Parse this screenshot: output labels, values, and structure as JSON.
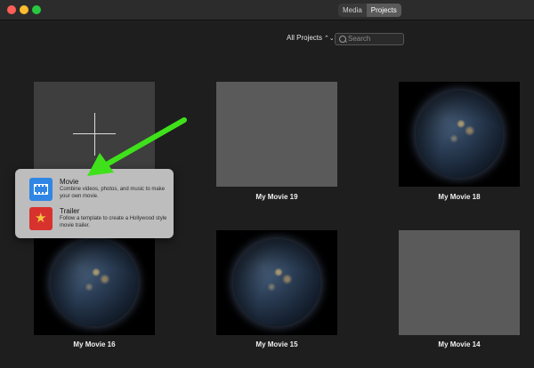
{
  "toolbar": {
    "tabs": [
      {
        "label": "Media",
        "active": false
      },
      {
        "label": "Projects",
        "active": true
      }
    ]
  },
  "filter": {
    "label": "All Projects",
    "icon": "up-down-chevron-icon"
  },
  "search": {
    "placeholder": "Search"
  },
  "popup": {
    "items": [
      {
        "title": "Movie",
        "description": "Combine videos, photos, and music to make your own movie.",
        "icon": "film-icon"
      },
      {
        "title": "Trailer",
        "description": "Follow a template to create a Hollywood style movie trailer.",
        "icon": "trailer-star-icon"
      }
    ]
  },
  "projects": [
    {
      "name": "My Movie 19",
      "thumb": "blank"
    },
    {
      "name": "My Movie 18",
      "thumb": "earth"
    },
    {
      "name": "My Movie 16",
      "thumb": "earth"
    },
    {
      "name": "My Movie 15",
      "thumb": "earth"
    },
    {
      "name": "My Movie 14",
      "thumb": "blank"
    }
  ],
  "annotation": {
    "arrow_color": "#3fe21a"
  },
  "colors": {
    "accent_movie": "#2f86e5",
    "accent_trailer": "#d8322e"
  }
}
